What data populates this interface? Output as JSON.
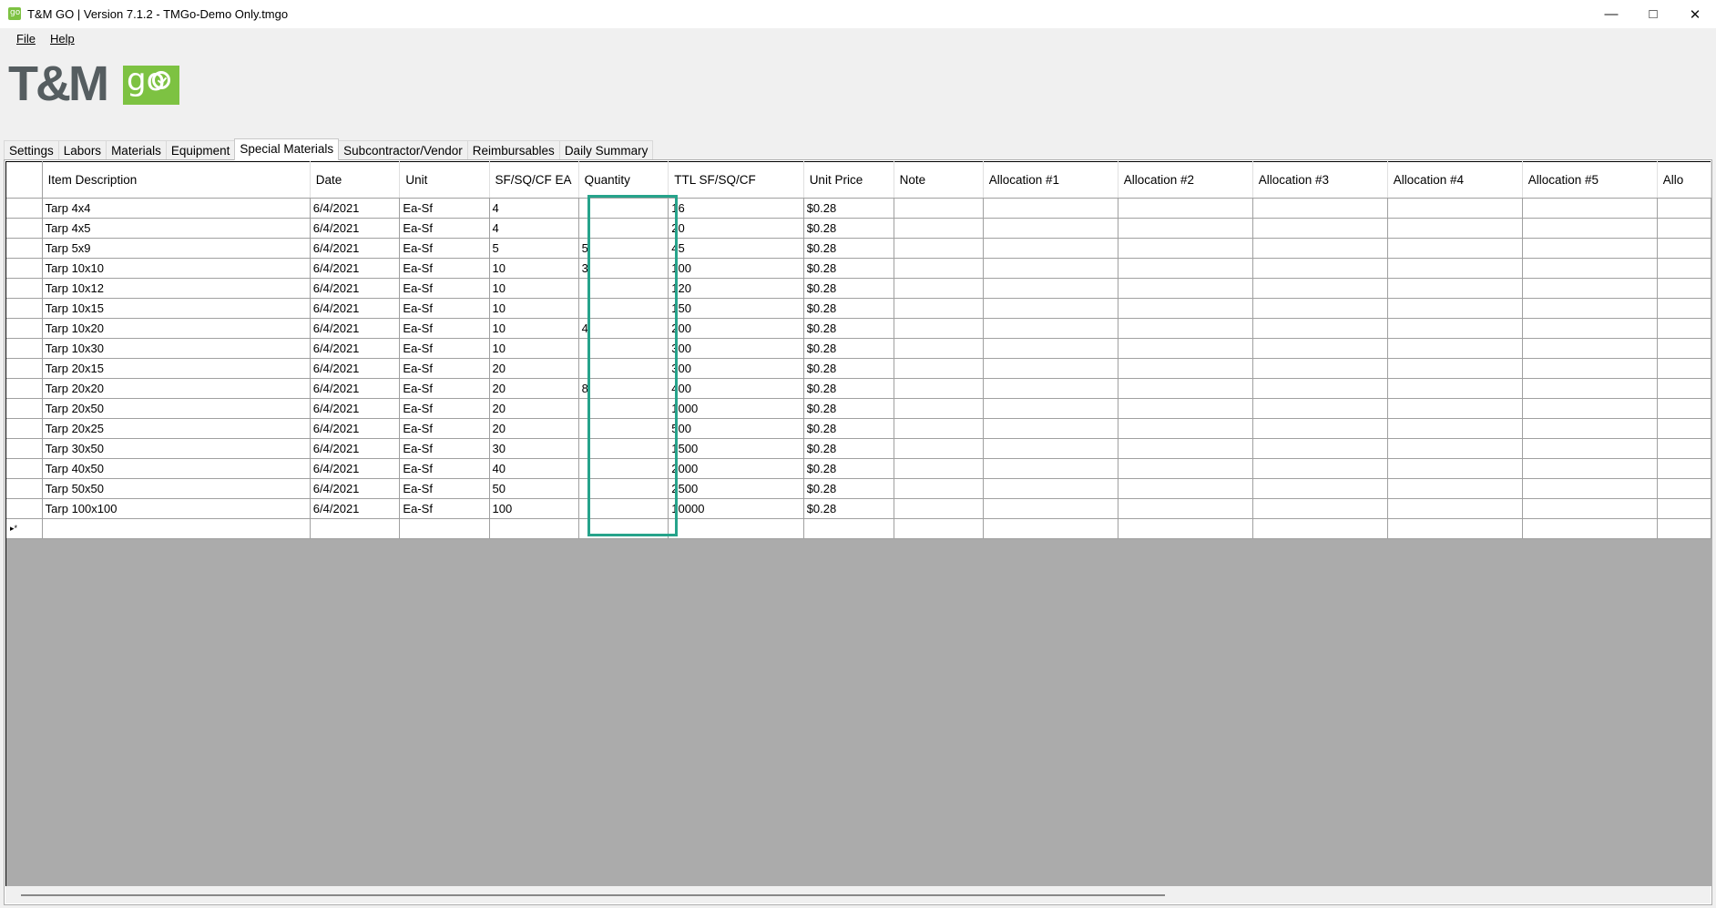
{
  "window": {
    "title": "T&M GO | Version 7.1.2 - TMGo-Demo Only.tmgo",
    "app_icon": "app-logo-icon",
    "controls": [
      "minimize-icon",
      "maximize-icon",
      "close-icon"
    ]
  },
  "menu": [
    {
      "label": "File",
      "mnemonic": "F"
    },
    {
      "label": "Help",
      "mnemonic": "H"
    }
  ],
  "logo": {
    "main": "T&M",
    "go": "go"
  },
  "tabs": [
    {
      "label": "Settings"
    },
    {
      "label": "Labors"
    },
    {
      "label": "Materials"
    },
    {
      "label": "Equipment"
    },
    {
      "label": "Special Materials",
      "active": true
    },
    {
      "label": "Subcontractor/Vendor"
    },
    {
      "label": "Reimbursables"
    },
    {
      "label": "Daily Summary"
    }
  ],
  "grid": {
    "columns": [
      "Item Description",
      "Date",
      "Unit",
      "SF/SQ/CF EA",
      "Quantity",
      "TTL SF/SQ/CF",
      "Unit Price",
      "Note",
      "Allocation #1",
      "Allocation #2",
      "Allocation #3",
      "Allocation #4",
      "Allocation #5",
      "Allo"
    ],
    "rows": [
      [
        "Tarp 4x4",
        "6/4/2021",
        "Ea-Sf",
        "4",
        "",
        "16",
        "$0.28"
      ],
      [
        "Tarp 4x5",
        "6/4/2021",
        "Ea-Sf",
        "4",
        "",
        "20",
        "$0.28"
      ],
      [
        "Tarp 5x9",
        "6/4/2021",
        "Ea-Sf",
        "5",
        "5",
        "45",
        "$0.28"
      ],
      [
        "Tarp 10x10",
        "6/4/2021",
        "Ea-Sf",
        "10",
        "3",
        "100",
        "$0.28"
      ],
      [
        "Tarp 10x12",
        "6/4/2021",
        "Ea-Sf",
        "10",
        "",
        "120",
        "$0.28"
      ],
      [
        "Tarp 10x15",
        "6/4/2021",
        "Ea-Sf",
        "10",
        "",
        "150",
        "$0.28"
      ],
      [
        "Tarp 10x20",
        "6/4/2021",
        "Ea-Sf",
        "10",
        "4",
        "200",
        "$0.28"
      ],
      [
        "Tarp 10x30",
        "6/4/2021",
        "Ea-Sf",
        "10",
        "",
        "300",
        "$0.28"
      ],
      [
        "Tarp 20x15",
        "6/4/2021",
        "Ea-Sf",
        "20",
        "",
        "300",
        "$0.28"
      ],
      [
        "Tarp 20x20",
        "6/4/2021",
        "Ea-Sf",
        "20",
        "8",
        "400",
        "$0.28"
      ],
      [
        "Tarp 20x50",
        "6/4/2021",
        "Ea-Sf",
        "20",
        "",
        "1000",
        "$0.28"
      ],
      [
        "Tarp 20x25",
        "6/4/2021",
        "Ea-Sf",
        "20",
        "",
        "500",
        "$0.28"
      ],
      [
        "Tarp 30x50",
        "6/4/2021",
        "Ea-Sf",
        "30",
        "",
        "1500",
        "$0.28"
      ],
      [
        "Tarp 40x50",
        "6/4/2021",
        "Ea-Sf",
        "40",
        "",
        "2000",
        "$0.28"
      ],
      [
        "Tarp 50x50",
        "6/4/2021",
        "Ea-Sf",
        "50",
        "",
        "2500",
        "$0.28"
      ],
      [
        "Tarp 100x100",
        "6/4/2021",
        "Ea-Sf",
        "100",
        "",
        "10000",
        "$0.28"
      ]
    ],
    "new_row_marker": "▸*"
  },
  "colors": {
    "highlight": "#26a38b",
    "brand_green": "#7dc242",
    "grid_background": "#ababab"
  }
}
